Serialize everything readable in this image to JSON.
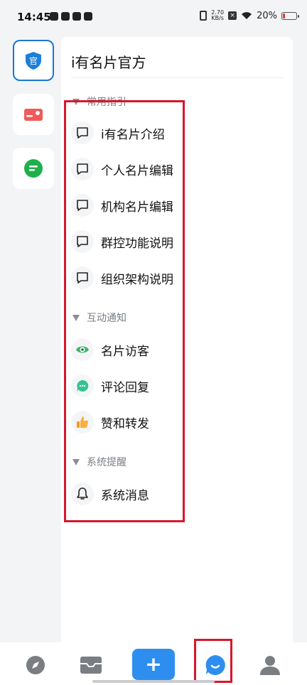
{
  "status_bar": {
    "time": "14:45",
    "net_speed_value": "2.70",
    "net_speed_unit": "KB/s",
    "battery_percent": "20%",
    "battery_level": 0.2,
    "battery_color": "#e53935"
  },
  "rail": {
    "items": [
      {
        "name": "official-account",
        "icon_text": "官",
        "color": "#1e7fd8",
        "active": true
      },
      {
        "name": "card",
        "color": "#f05a5a",
        "active": false
      },
      {
        "name": "message",
        "color": "#20b04b",
        "active": false
      }
    ]
  },
  "panel": {
    "title": "i有名片官方",
    "sections": [
      {
        "label": "常用指引",
        "items": [
          {
            "label": "i有名片介绍",
            "icon": "chat-bubble-icon"
          },
          {
            "label": "个人名片编辑",
            "icon": "chat-bubble-icon"
          },
          {
            "label": "机构名片编辑",
            "icon": "chat-bubble-icon"
          },
          {
            "label": "群控功能说明",
            "icon": "chat-bubble-icon"
          },
          {
            "label": "组织架构说明",
            "icon": "chat-bubble-icon"
          }
        ]
      },
      {
        "label": "互动通知",
        "items": [
          {
            "label": "名片访客",
            "icon": "eye-icon"
          },
          {
            "label": "评论回复",
            "icon": "comment-icon"
          },
          {
            "label": "赞和转发",
            "icon": "thumbs-up-icon"
          }
        ]
      },
      {
        "label": "系统提醒",
        "items": [
          {
            "label": "系统消息",
            "icon": "bell-icon"
          }
        ]
      }
    ]
  },
  "bottom_nav": {
    "items": [
      {
        "name": "discover",
        "icon": "compass-icon"
      },
      {
        "name": "inbox",
        "icon": "inbox-icon"
      },
      {
        "name": "add",
        "icon": "plus-icon",
        "label": "+"
      },
      {
        "name": "messages",
        "icon": "chat-icon",
        "active": true
      },
      {
        "name": "profile",
        "icon": "user-icon"
      }
    ]
  },
  "colors": {
    "accent": "#2e8ef0",
    "highlight": "#d7172b",
    "rail_active_border": "#1976d2"
  }
}
